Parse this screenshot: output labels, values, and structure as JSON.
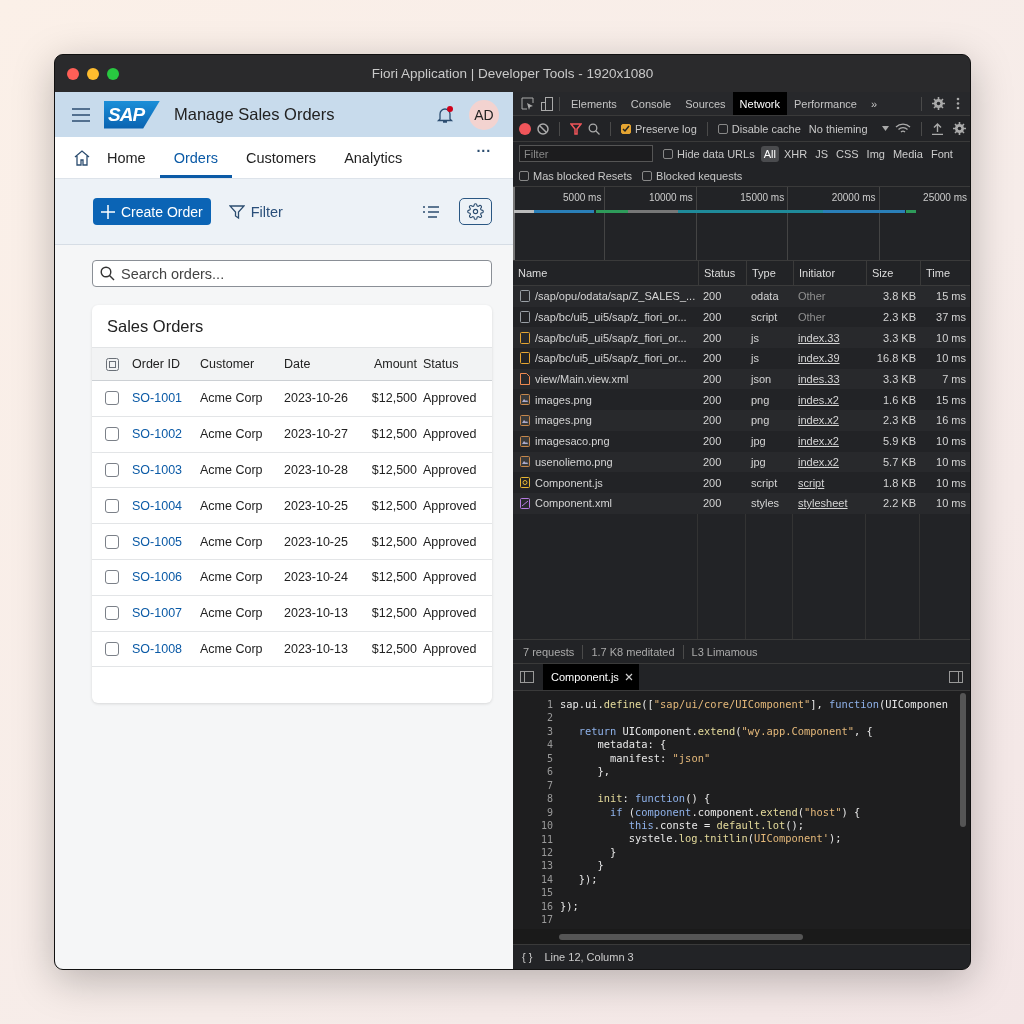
{
  "window": {
    "title": "Fiori Application | Developer Tools - 1920x1080"
  },
  "app": {
    "logo": "SAP",
    "title": "Manage Sales Orders",
    "notification": true,
    "avatar": "AD",
    "nav": [
      {
        "label": "Home",
        "selected": false
      },
      {
        "label": "Orders",
        "selected": true
      },
      {
        "label": "Customers",
        "selected": false
      },
      {
        "label": "Analytics",
        "selected": false
      }
    ],
    "nav_more": "···",
    "create_button": "Create Order",
    "filter_button": "Filter",
    "search": {
      "placeholder": "Search orders..."
    },
    "table": {
      "title": "Sales Orders",
      "columns": [
        "Order ID",
        "Customer",
        "Date",
        "Amount",
        "Status"
      ],
      "rows": [
        {
          "id": "SO-1001",
          "customer": "Acme Corp",
          "date": "2023-10-26",
          "amount": "$12,500",
          "status": "Approved",
          "checked": false
        },
        {
          "id": "SO-1002",
          "customer": "Acme Corp",
          "date": "2023-10-27",
          "amount": "$12,500",
          "status": "Approved",
          "checked": false
        },
        {
          "id": "SO-1003",
          "customer": "Acme Corp",
          "date": "2023-10-28",
          "amount": "$12,500",
          "status": "Approved",
          "checked": false
        },
        {
          "id": "SO-1004",
          "customer": "Acme Corp",
          "date": "2023-10-25",
          "amount": "$12,500",
          "status": "Approved",
          "checked": false
        },
        {
          "id": "SO-1005",
          "customer": "Acme Corp",
          "date": "2023-10-25",
          "amount": "$12,500",
          "status": "Approved",
          "checked": false
        },
        {
          "id": "SO-1006",
          "customer": "Acme Corp",
          "date": "2023-10-24",
          "amount": "$12,500",
          "status": "Approved",
          "checked": false
        },
        {
          "id": "SO-1007",
          "customer": "Acme Corp",
          "date": "2023-10-13",
          "amount": "$12,500",
          "status": "Approved",
          "checked": false
        },
        {
          "id": "SO-1008",
          "customer": "Acme Corp",
          "date": "2023-10-13",
          "amount": "$12,500",
          "status": "Approved",
          "checked": false
        }
      ]
    }
  },
  "devtools": {
    "tabs": [
      {
        "label": "Elements",
        "selected": false
      },
      {
        "label": "Console",
        "selected": false
      },
      {
        "label": "Sources",
        "selected": false
      },
      {
        "label": "Network",
        "selected": true
      },
      {
        "label": "Performance",
        "selected": false
      }
    ],
    "tabs_more": "»",
    "preserve_log": {
      "label": "Preserve log",
      "checked": true
    },
    "disable_cache": {
      "label": "Disable cache",
      "checked": false
    },
    "throttling": "No thieming",
    "filter": {
      "placeholder": "Filter"
    },
    "hide_data_urls": {
      "label": "Hide data URLs",
      "checked": false
    },
    "types": [
      {
        "label": "All",
        "selected": true
      },
      {
        "label": "XHR",
        "selected": false
      },
      {
        "label": "JS",
        "selected": false
      },
      {
        "label": "CSS",
        "selected": false
      },
      {
        "label": "Img",
        "selected": false
      },
      {
        "label": "Media",
        "selected": false
      },
      {
        "label": "Font",
        "selected": false
      }
    ],
    "blocked_resets": {
      "label": "Mas blocked Resets",
      "checked": false
    },
    "blocked_requests": {
      "label": "Blocked kequests",
      "checked": false
    },
    "timeline_ticks": [
      "5000 ms",
      "10000 ms",
      "15000 ms",
      "20000 ms",
      "25000 ms"
    ],
    "columns": [
      "Name",
      "Status",
      "Type",
      "Initiator",
      "Size",
      "Time"
    ],
    "requests": [
      {
        "kind": "doc",
        "name": "/sap/opu/odata/sap/Z_SALES_...",
        "status": "200",
        "type": "odata",
        "initiator": "Other",
        "link": false,
        "size": "3.8 KB",
        "time": "15 ms"
      },
      {
        "kind": "doc",
        "name": "/sap/bc/ui5_ui5/sap/z_fiori_or...",
        "status": "200",
        "type": "script",
        "initiator": "Other",
        "link": false,
        "size": "2.3 KB",
        "time": "37 ms"
      },
      {
        "kind": "script",
        "name": "/sap/bc/ui5_ui5/sap/z_fiori_or...",
        "status": "200",
        "type": "js",
        "initiator": "index.33",
        "link": true,
        "size": "3.3 KB",
        "time": "10 ms"
      },
      {
        "kind": "script",
        "name": "/sap/bc/ui5_ui5/sap/z_fiori_or...",
        "status": "200",
        "type": "js",
        "initiator": "index.39",
        "link": true,
        "size": "16.8 KB",
        "time": "10 ms"
      },
      {
        "kind": "file",
        "name": "view/Main.view.xml",
        "status": "200",
        "type": "json",
        "initiator": "indes.33",
        "link": true,
        "size": "3.3 KB",
        "time": "7 ms"
      },
      {
        "kind": "image",
        "name": "images.png",
        "status": "200",
        "type": "png",
        "initiator": "indes.x2",
        "link": true,
        "size": "1.6 KB",
        "time": "15 ms"
      },
      {
        "kind": "image",
        "name": "images.png",
        "status": "200",
        "type": "png",
        "initiator": "index.x2",
        "link": true,
        "size": "2.3 KB",
        "time": "16 ms"
      },
      {
        "kind": "image",
        "name": "imagesaco.png",
        "status": "200",
        "type": "jpg",
        "initiator": "index.x2",
        "link": true,
        "size": "5.9 KB",
        "time": "10 ms"
      },
      {
        "kind": "image",
        "name": "usenoliemo.png",
        "status": "200",
        "type": "jpg",
        "initiator": "index.x2",
        "link": true,
        "size": "5.7 KB",
        "time": "10 ms"
      },
      {
        "kind": "js",
        "name": "Component.js",
        "status": "200",
        "type": "script",
        "initiator": "script",
        "link": true,
        "size": "1.8 KB",
        "time": "10 ms"
      },
      {
        "kind": "style",
        "name": "Component.xml",
        "status": "200",
        "type": "styles",
        "initiator": "stylesheet",
        "link": true,
        "size": "2.2 KB",
        "time": "10 ms"
      }
    ],
    "summary": [
      "7 requests",
      "1.7 K8 meditated",
      "L3 Limamous"
    ],
    "editor_tab": "Component.js",
    "code": [
      {
        "number": "1",
        "tokens": [
          {
            "kind": "plain",
            "text": "sap.ui."
          },
          {
            "kind": "func",
            "text": "define"
          },
          {
            "kind": "plain",
            "text": "(["
          },
          {
            "kind": "string",
            "text": "\"sap/ui/core/UIComponent\""
          },
          {
            "kind": "plain",
            "text": "], "
          },
          {
            "kind": "keyword",
            "text": "function"
          },
          {
            "kind": "plain",
            "text": "(UIComponen"
          }
        ]
      },
      {
        "number": "2"
      },
      {
        "number": "3",
        "tokens": [
          {
            "kind": "keyword",
            "text": "   return"
          },
          {
            "kind": "plain",
            "text": " UIComponent."
          },
          {
            "kind": "func",
            "text": "extend"
          },
          {
            "kind": "plain",
            "text": "("
          },
          {
            "kind": "string",
            "text": "\"wy.app.Component\""
          },
          {
            "kind": "plain",
            "text": ", {"
          }
        ]
      },
      {
        "number": "4",
        "tokens": [
          {
            "kind": "plain",
            "text": "      metadata: {"
          }
        ]
      },
      {
        "number": "5",
        "tokens": [
          {
            "kind": "plain",
            "text": "        manifest: "
          },
          {
            "kind": "string",
            "text": "\"json\""
          }
        ]
      },
      {
        "number": "6",
        "tokens": [
          {
            "kind": "plain",
            "text": "      },"
          }
        ]
      },
      {
        "number": "7"
      },
      {
        "number": "8",
        "tokens": [
          {
            "kind": "func",
            "text": "      init"
          },
          {
            "kind": "plain",
            "text": ": "
          },
          {
            "kind": "keyword",
            "text": "function"
          },
          {
            "kind": "plain",
            "text": "() {"
          }
        ]
      },
      {
        "number": "9",
        "tokens": [
          {
            "kind": "keyword",
            "text": "        if"
          },
          {
            "kind": "plain",
            "text": " ("
          },
          {
            "kind": "keyword",
            "text": "component"
          },
          {
            "kind": "plain",
            "text": ".component."
          },
          {
            "kind": "func",
            "text": "extend"
          },
          {
            "kind": "plain",
            "text": "("
          },
          {
            "kind": "string",
            "text": "\"host\""
          },
          {
            "kind": "plain",
            "text": ") {"
          }
        ]
      },
      {
        "number": "10",
        "tokens": [
          {
            "kind": "keyword",
            "text": "           this"
          },
          {
            "kind": "plain",
            "text": ".conste = "
          },
          {
            "kind": "func",
            "text": "default.lot"
          },
          {
            "kind": "plain",
            "text": "();"
          }
        ]
      },
      {
        "number": "11",
        "tokens": [
          {
            "kind": "plain",
            "text": "           systele."
          },
          {
            "kind": "func",
            "text": "log.tnitlin"
          },
          {
            "kind": "plain",
            "text": "("
          },
          {
            "kind": "string",
            "text": "UIComponent'"
          },
          {
            "kind": "plain",
            "text": ");"
          }
        ]
      },
      {
        "number": "12",
        "tokens": [
          {
            "kind": "plain",
            "text": "        }"
          }
        ]
      },
      {
        "number": "13",
        "tokens": [
          {
            "kind": "plain",
            "text": "      }"
          }
        ]
      },
      {
        "number": "14",
        "tokens": [
          {
            "kind": "plain",
            "text": "   });"
          }
        ]
      },
      {
        "number": "15"
      },
      {
        "number": "16",
        "tokens": [
          {
            "kind": "plain",
            "text": "});"
          }
        ]
      },
      {
        "number": "17"
      }
    ],
    "braces": "{ }",
    "cursor": "Line 12, Column 3"
  }
}
